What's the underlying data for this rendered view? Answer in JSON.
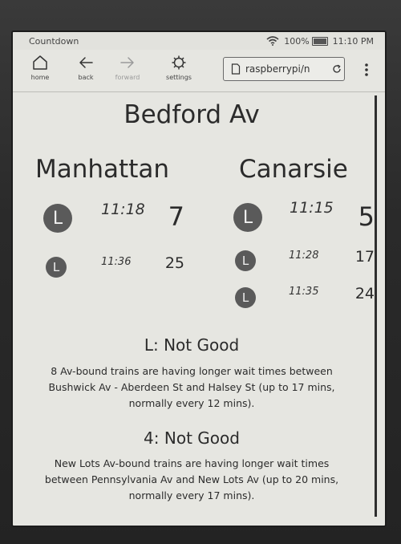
{
  "status_bar": {
    "title": "Countdown",
    "battery": "100%",
    "battery_level": 1.0,
    "time": "11:10 PM"
  },
  "toolbar": {
    "home_label": "home",
    "back_label": "back",
    "forward_label": "forward",
    "settings_label": "settings",
    "url": "raspberrypi/n"
  },
  "page": {
    "station": "Bedford Av",
    "directions": [
      {
        "name": "Manhattan",
        "trains": [
          {
            "line": "L",
            "time": "11:18",
            "minutes": "7"
          },
          {
            "line": "L",
            "time": "11:36",
            "minutes": "25"
          }
        ]
      },
      {
        "name": "Canarsie",
        "trains": [
          {
            "line": "L",
            "time": "11:15",
            "minutes": "5"
          },
          {
            "line": "L",
            "time": "11:28",
            "minutes": "17"
          },
          {
            "line": "L",
            "time": "11:35",
            "minutes": "24"
          }
        ]
      }
    ],
    "alerts": [
      {
        "title": "L: Not Good",
        "body_lines": [
          "8 Av-bound trains are having longer wait times between",
          "Bushwick Av - Aberdeen St and Halsey St (up to 17 mins,",
          "normally every 12 mins)."
        ]
      },
      {
        "title": "4: Not Good",
        "body_lines": [
          "New Lots Av-bound trains are having longer wait times",
          "between Pennsylvania Av and New Lots Av (up to 20 mins,",
          "normally every 17 mins)."
        ]
      }
    ]
  }
}
